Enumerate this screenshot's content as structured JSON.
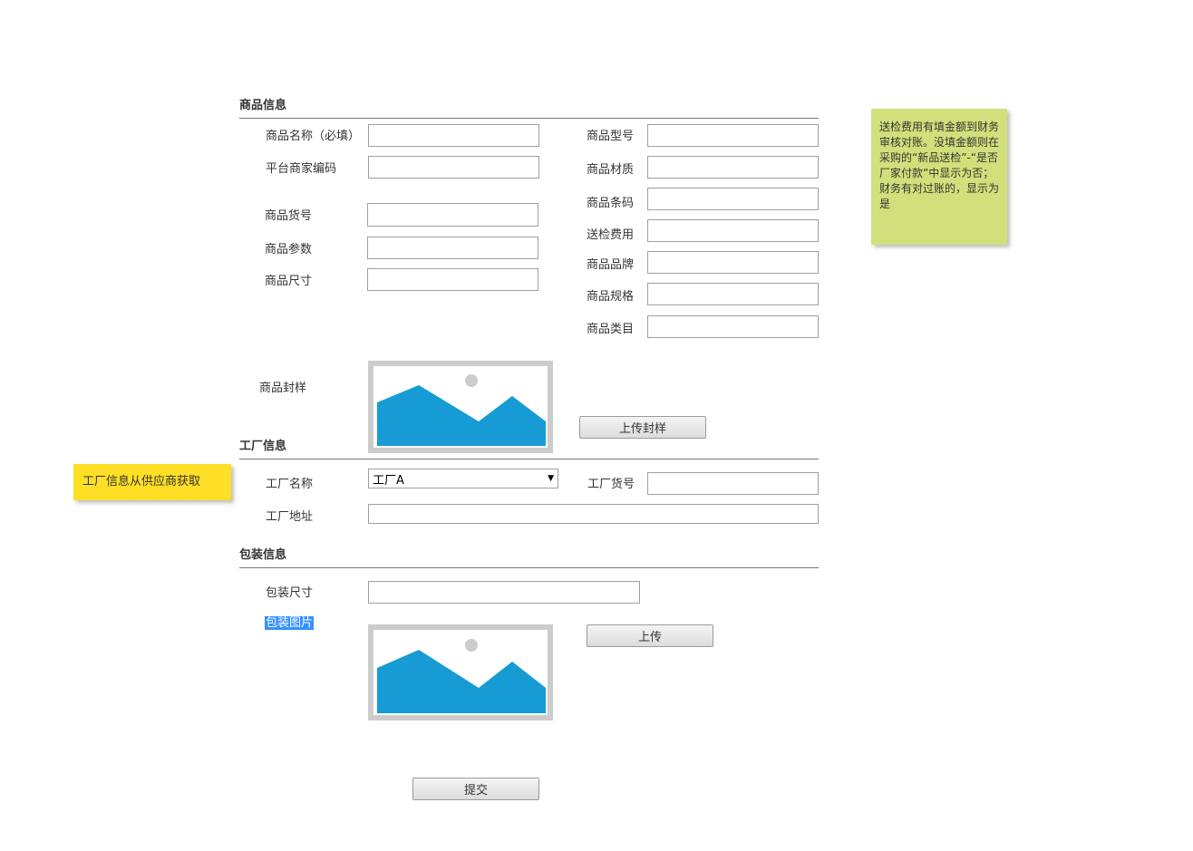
{
  "product_section": {
    "title": "商品信息",
    "fields_left": [
      {
        "label": "商品名称（必填）"
      },
      {
        "label": "平台商家编码"
      },
      {
        "label": "商品货号"
      },
      {
        "label": "商品参数"
      },
      {
        "label": "商品尺寸"
      }
    ],
    "fields_right": [
      {
        "label": "商品型号"
      },
      {
        "label": "商品材质"
      },
      {
        "label": "商品条码"
      },
      {
        "label": "送检费用"
      },
      {
        "label": "商品品牌"
      },
      {
        "label": "商品规格"
      },
      {
        "label": "商品类目"
      }
    ],
    "sample_label": "商品封样",
    "upload_sample_button": "上传封样"
  },
  "factory_section": {
    "title": "工厂信息",
    "factory_name_label": "工厂名称",
    "factory_name_selected": "工厂A",
    "factory_sku_label": "工厂货号",
    "factory_address_label": "工厂地址"
  },
  "packaging_section": {
    "title": "包装信息",
    "size_label": "包装尺寸",
    "image_label": "包装图片",
    "upload_button": "上传"
  },
  "submit_button": "提交",
  "notes": {
    "finance": "送检费用有填金额到财务审核对账。没填金额则在采购的“新品送检”-“是否厂家付款”中显示为否；财务有对过账的，显示为是",
    "factory": "工厂信息从供应商获取"
  },
  "colors": {
    "note_green": "#d1e07a",
    "note_yellow": "#ffdf25",
    "image_blue": "#169bd5",
    "selection_blue": "#3390ff"
  },
  "icons": {
    "image_placeholder": "image-placeholder-icon",
    "dropdown": "triangle-down"
  }
}
